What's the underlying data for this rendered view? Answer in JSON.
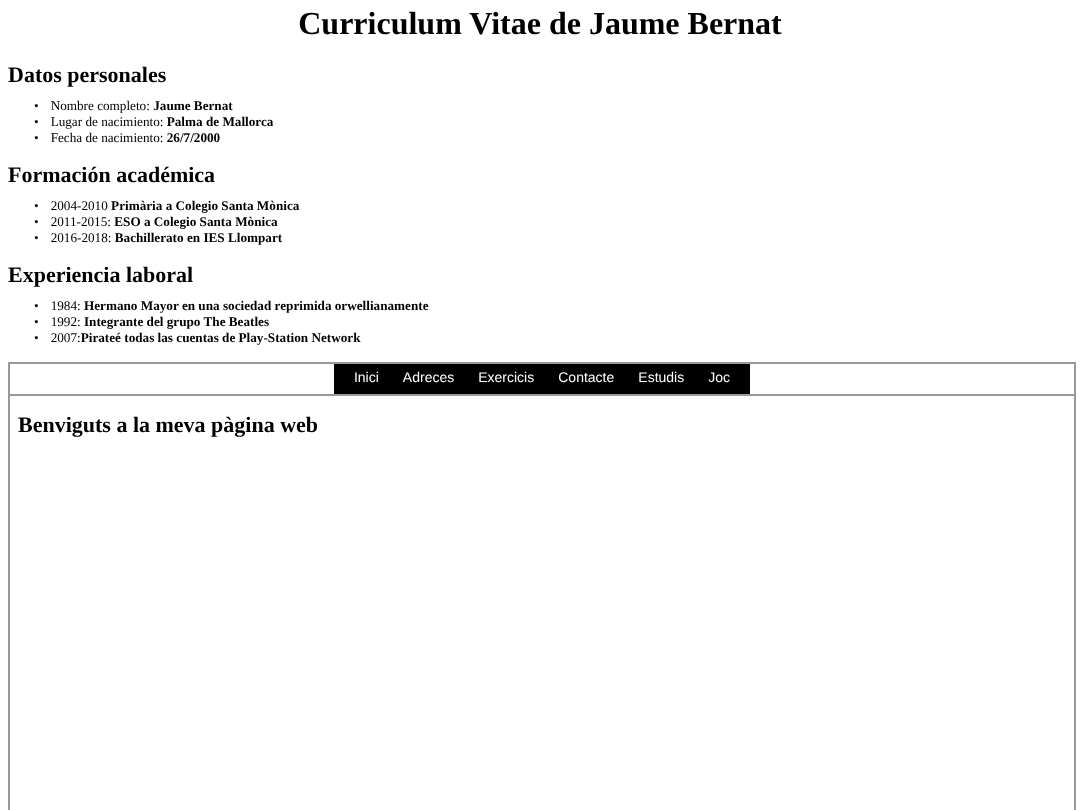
{
  "title": "Curriculum Vitae de Jaume Bernat",
  "sections": [
    {
      "heading": "Datos personales",
      "items": [
        {
          "marker": "•",
          "text": "Nombre completo: **Jaume Bernat**"
        },
        {
          "marker": "•",
          "text": "Lugar de nacimiento: **Palma de Mallorca**"
        },
        {
          "marker": "•",
          "text": "Fecha de nacimiento: **26/7/2000**"
        }
      ]
    },
    {
      "heading": "Formación académica",
      "items": [
        {
          "marker": "•",
          "text": "2004-2010 **Primària a Colegio Santa Mònica**"
        },
        {
          "marker": "•",
          "text": "2011-2015: **ESO a Colegio Santa Mònica**"
        },
        {
          "marker": "•",
          "text": "2016-2018: **Bachillerato en IES Llompart**"
        }
      ]
    },
    {
      "heading": "Experiencia laboral",
      "items": [
        {
          "marker": "•",
          "text": "1984: **Hermano Mayor en una sociedad reprimida orwellianamente**"
        },
        {
          "marker": "•",
          "text": "1992: **Integrante del grupo The Beatles**"
        },
        {
          "marker": "•",
          "text": "2007:**Pirateé todas las cuentas de Play-Station Network**"
        }
      ]
    }
  ],
  "frame": {
    "nav": [
      "Inici",
      "Adreces",
      "Exercicis",
      "Contacte",
      "Estudis",
      "Joc"
    ],
    "heading": "Benviguts a la meva pàgina web"
  }
}
